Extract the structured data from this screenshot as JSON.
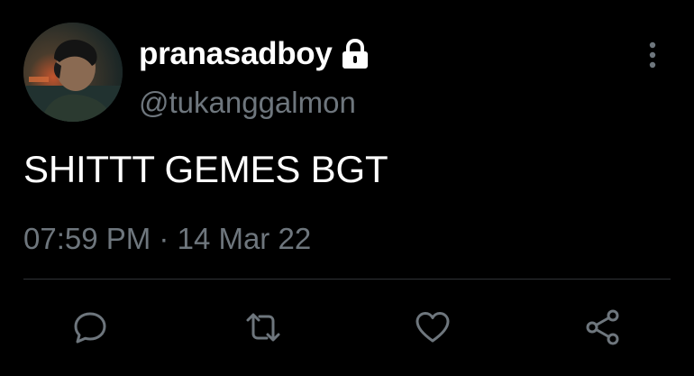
{
  "tweet": {
    "display_name": "pranasadboy",
    "handle": "@tukanggalmon",
    "text": "SHITTT GEMES BGT",
    "time": "07:59 PM",
    "separator": "·",
    "date": "14 Mar 22",
    "protected_icon": "lock-icon",
    "avatar": "profile-photo"
  },
  "actions": [
    {
      "name": "reply",
      "icon": "reply-icon"
    },
    {
      "name": "retweet",
      "icon": "retweet-icon"
    },
    {
      "name": "like",
      "icon": "like-icon"
    },
    {
      "name": "share",
      "icon": "share-icon"
    }
  ],
  "colors": {
    "background": "#000000",
    "text": "#ffffff",
    "secondary": "#6e767d",
    "divider": "#2f3336"
  }
}
